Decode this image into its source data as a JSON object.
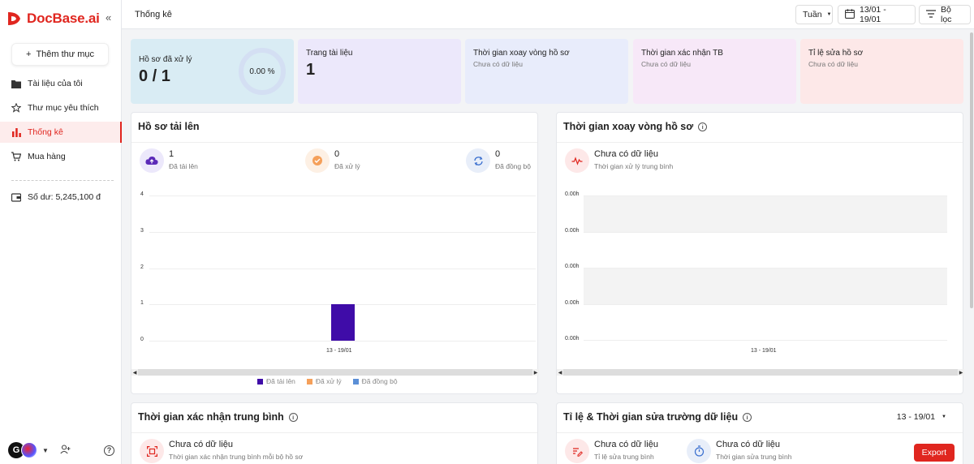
{
  "app": {
    "logo_text": "DocBase.ai",
    "collapse_icon": "chevrons-left-icon",
    "brand_color": "#e0261f"
  },
  "sidebar": {
    "add_folder": "Thêm thư mục",
    "items": [
      {
        "label": "Tài liệu của tôi",
        "icon": "folder-icon"
      },
      {
        "label": "Thư mục yêu thích",
        "icon": "star-icon"
      },
      {
        "label": "Thống kê",
        "icon": "bar-chart-icon",
        "active": true
      },
      {
        "label": "Mua hàng",
        "icon": "cart-icon"
      }
    ],
    "balance": "Số dư: 5,245,100 đ",
    "avatar_letter": "G"
  },
  "header": {
    "title": "Thống kê",
    "period": "Tuần",
    "date_range": "13/01 - 19/01",
    "filter": "Bộ lọc"
  },
  "stats": [
    {
      "label": "Hồ sơ đã xử lý",
      "value": "0 / 1",
      "ring_value": "0.00 %",
      "bg": "#d9ecf4"
    },
    {
      "label": "Trang tài liệu",
      "value": "1",
      "bg": "#ece8fb"
    },
    {
      "label": "Thời gian xoay vòng hồ sơ",
      "sub": "Chưa có dữ liệu",
      "bg": "#e8ecfb"
    },
    {
      "label": "Thời gian xác nhận TB",
      "sub": "Chưa có dữ liệu",
      "bg": "#f7e8f8"
    },
    {
      "label": "Tỉ lệ sửa hồ sơ",
      "sub": "Chưa có dữ liệu",
      "bg": "#fde8e8"
    }
  ],
  "uploads_panel": {
    "title": "Hồ sơ tải lên",
    "metrics": [
      {
        "value": "1",
        "label": "Đã tải lên",
        "icon": "cloud-upload-icon"
      },
      {
        "value": "0",
        "label": "Đã xử lý",
        "icon": "check-badge-icon"
      },
      {
        "value": "0",
        "label": "Đã đồng bộ",
        "icon": "sync-icon"
      }
    ],
    "legend": [
      "Đã tải lên",
      "Đã xử lý",
      "Đã đồng bộ"
    ]
  },
  "chart_data": [
    {
      "type": "bar",
      "categories": [
        "13 - 19/01"
      ],
      "series": [
        {
          "name": "Đã tải lên",
          "values": [
            1
          ],
          "color": "#3f0ca8"
        },
        {
          "name": "Đã xử lý",
          "values": [
            0
          ],
          "color": "#f5a05a"
        },
        {
          "name": "Đã đồng bộ",
          "values": [
            0
          ],
          "color": "#5b8fd6"
        }
      ],
      "yticks": [
        "0",
        "1",
        "2",
        "3",
        "4"
      ],
      "ylim": [
        0,
        4
      ],
      "legend": "bottom"
    },
    {
      "type": "area",
      "categories": [
        "13 - 19/01"
      ],
      "series": [],
      "yticks": [
        "0.00h",
        "0.00h",
        "0.00h",
        "0.00h",
        "0.00h"
      ]
    }
  ],
  "turnaround_panel": {
    "title": "Thời gian xoay vòng hồ sơ",
    "empty": "Chưa có dữ liệu",
    "desc": "Thời gian xử lý trung bình"
  },
  "confirm_panel": {
    "title": "Thời gian xác nhận trung bình",
    "empty": "Chưa có dữ liệu",
    "desc": "Thời gian xác nhận trung bình mỗi bộ hồ sơ"
  },
  "edit_panel": {
    "title": "Tỉ lệ & Thời gian sửa trường dữ liệu",
    "range": "13 - 19/01",
    "items": [
      {
        "empty": "Chưa có dữ liệu",
        "desc": "Tỉ lệ sửa trung bình"
      },
      {
        "empty": "Chưa có dữ liệu",
        "desc": "Thời gian sửa trung bình"
      }
    ],
    "export": "Export"
  }
}
